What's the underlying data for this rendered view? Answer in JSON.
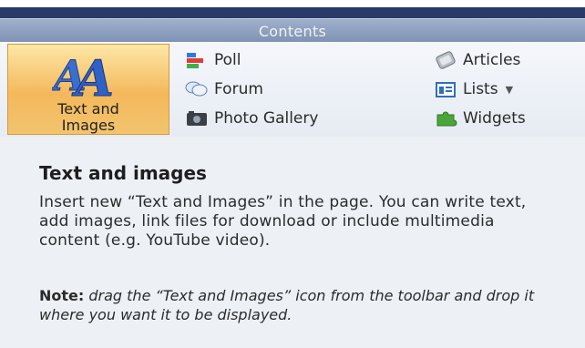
{
  "header": {
    "title": "Contents"
  },
  "ribbon": {
    "text_images": {
      "label_line1": "Text and",
      "label_line2": "Images",
      "icon": "text-and-images-icon"
    },
    "items": [
      {
        "label": "Poll",
        "icon": "poll-icon"
      },
      {
        "label": "Forum",
        "icon": "forum-icon"
      },
      {
        "label": "Photo Gallery",
        "icon": "photo-gallery-icon"
      },
      {
        "label": "Articles",
        "icon": "articles-icon"
      },
      {
        "label": "Lists",
        "icon": "lists-icon",
        "has_dropdown": true
      },
      {
        "label": "Widgets",
        "icon": "widgets-icon"
      }
    ]
  },
  "help": {
    "title": "Text and images",
    "description": "Insert new “Text and Images” in the page. You can write text, add images, link files for download or include multimedia content (e.g. YouTube video).",
    "note_label": "Note:",
    "note_text": "drag the “Text and Images” icon from the toolbar and drop it where you want it to be displayed."
  }
}
